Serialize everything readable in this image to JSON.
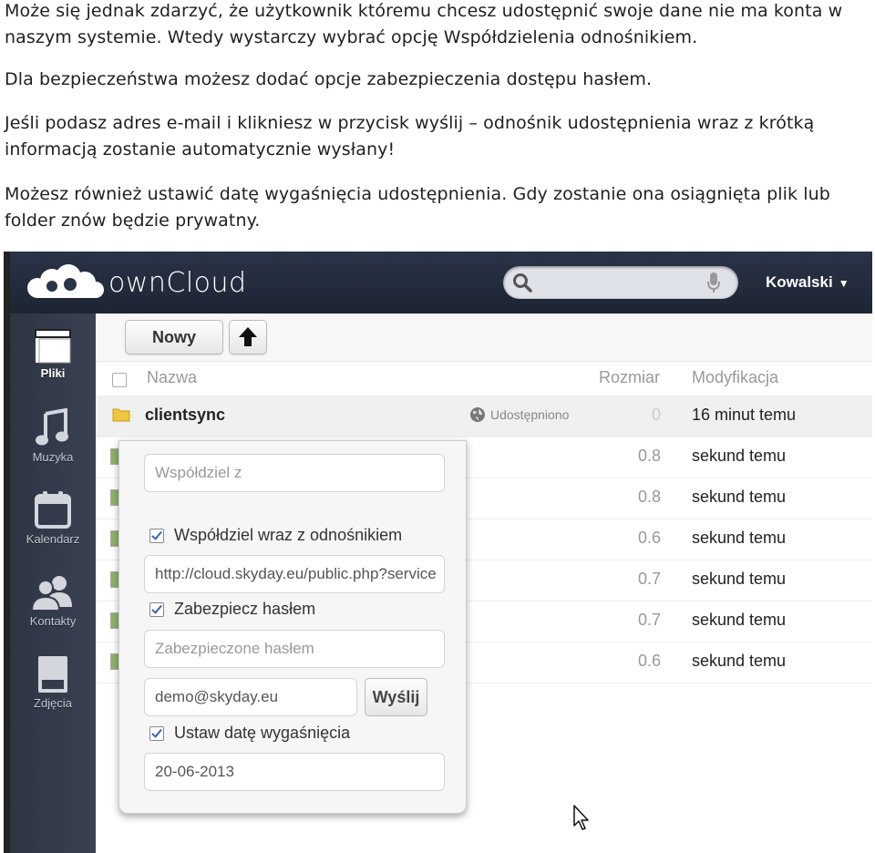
{
  "document": {
    "p1": "Może się jednak zdarzyć, że użytkownik któremu chcesz udostępnić swoje dane nie ma konta w naszym systemie. Wtedy wystarczy wybrać opcję Współdzielenia odnośnikiem.",
    "p2": "Dla bezpieczeństwa możesz dodać opcje zabezpieczenia dostępu hasłem.",
    "p3": "Jeśli podasz adres e-mail i klikniesz w przycisk wyślij – odnośnik udostępnienia wraz z krótką informacją zostanie automatycznie wysłany!",
    "p4": "Możesz również ustawić datę wygaśnięcia udostępnienia. Gdy zostanie ona osiągnięta plik lub folder znów będzie prywatny."
  },
  "app": {
    "logo_text": "ownCloud",
    "user": "Kowalski",
    "search_placeholder": ""
  },
  "sidebar": {
    "items": [
      {
        "label": "Pliki",
        "icon": "folder-icon",
        "active": true
      },
      {
        "label": "Muzyka",
        "icon": "music-icon"
      },
      {
        "label": "Kalendarz",
        "icon": "calendar-icon"
      },
      {
        "label": "Kontakty",
        "icon": "contacts-icon"
      },
      {
        "label": "Zdjęcia",
        "icon": "photos-icon"
      }
    ]
  },
  "toolbar": {
    "new_label": "Nowy",
    "upload_icon": "upload-arrow-icon"
  },
  "table": {
    "headers": {
      "name": "Nazwa",
      "size": "Rozmiar",
      "modified": "Modyfikacja"
    },
    "rows": [
      {
        "name": "clientsync",
        "shared": "Udostępniono",
        "size": "0",
        "modified": "16 minut temu"
      },
      {
        "size": "0.8",
        "modified": "sekund temu"
      },
      {
        "size": "0.8",
        "modified": "sekund temu"
      },
      {
        "size": "0.6",
        "modified": "sekund temu"
      },
      {
        "size": "0.7",
        "modified": "sekund temu"
      },
      {
        "size": "0.7",
        "modified": "sekund temu"
      },
      {
        "size": "0.6",
        "modified": "sekund temu"
      }
    ]
  },
  "share_popup": {
    "share_with_placeholder": "Współdziel z",
    "link_checkbox_label": "Współdziel wraz z odnośnikiem",
    "link_url": "http://cloud.skyday.eu/public.php?service",
    "password_checkbox_label": "Zabezpiecz hasłem",
    "password_placeholder": "Zabezpieczone hasłem",
    "email_value": "demo@skyday.eu",
    "send_label": "Wyślij",
    "expire_checkbox_label": "Ustaw datę wygaśnięcia",
    "expire_date": "20-06-2013"
  }
}
